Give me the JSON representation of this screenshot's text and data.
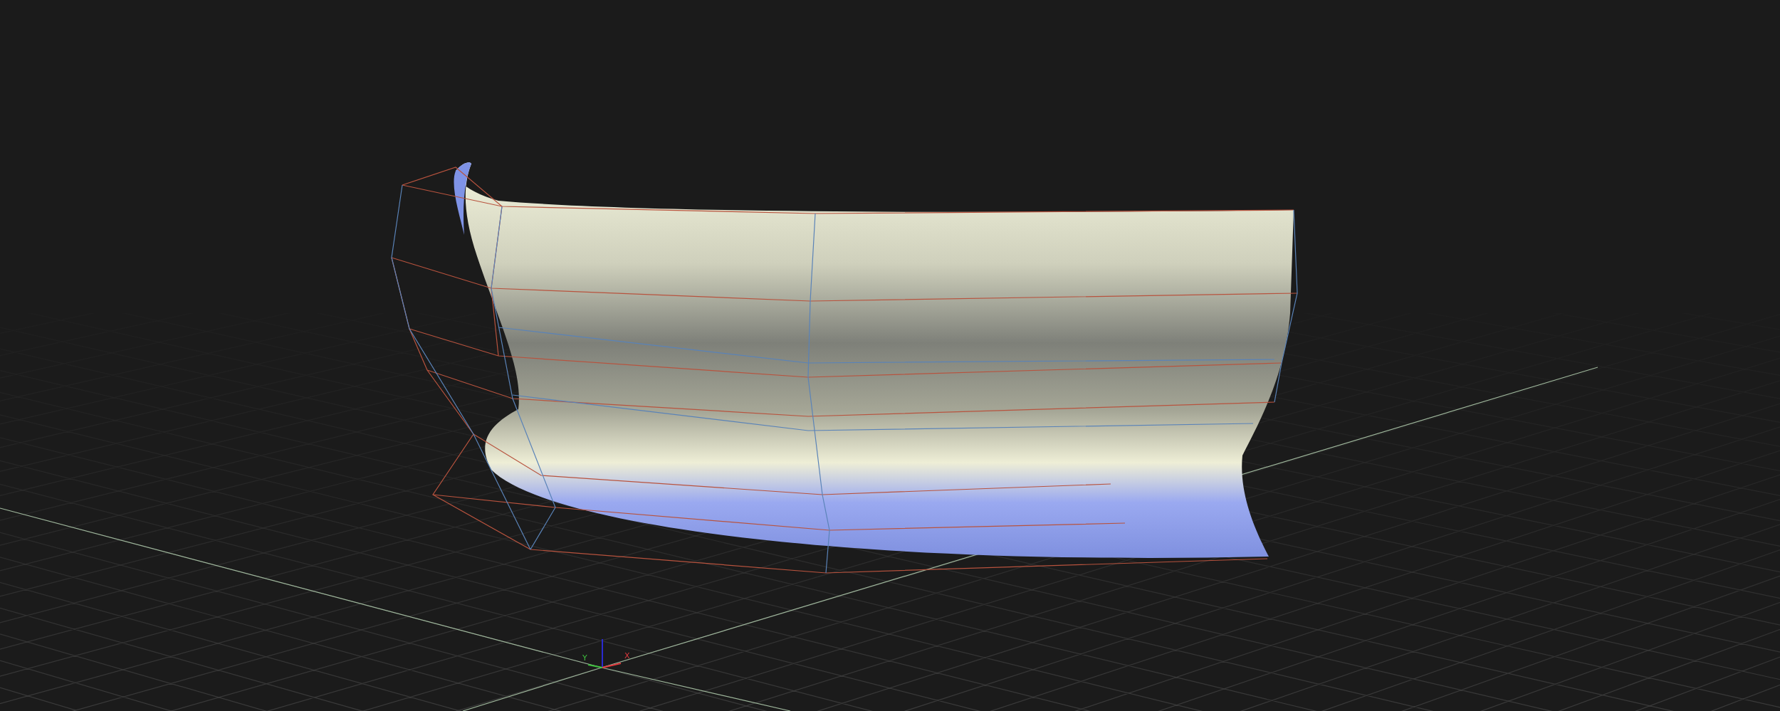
{
  "viewport": {
    "axis_gizmo": [
      {
        "kind": "y",
        "label": "Y"
      },
      {
        "kind": "x",
        "label": "X"
      }
    ]
  }
}
